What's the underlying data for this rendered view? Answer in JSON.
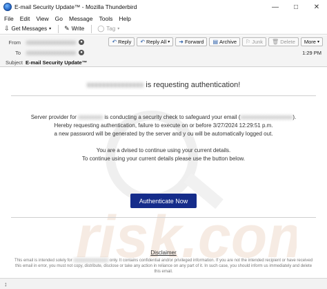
{
  "window": {
    "title": "E-mail Security Update™ - Mozilla Thunderbird"
  },
  "menu": [
    "File",
    "Edit",
    "View",
    "Go",
    "Message",
    "Tools",
    "Help"
  ],
  "toolbar": {
    "get_messages": "Get Messages",
    "write": "Write",
    "tag": "Tag"
  },
  "header": {
    "from_label": "From",
    "to_label": "To",
    "subject_label": "Subject",
    "subject": "E-mail Security Update™",
    "time": "1:29 PM",
    "actions": {
      "reply": "Reply",
      "reply_all": "Reply All",
      "forward": "Forward",
      "archive": "Archive",
      "junk": "Junk",
      "delete": "Delete",
      "more": "More"
    }
  },
  "body": {
    "title_suffix": " is requesting authentication!",
    "line1_a": "Server provider for ",
    "line1_b": " is conducting a security check to safeguard your email (",
    "line1_c": ").",
    "line2": "Hereby requesting authentication, failure to execute on or before 3/27/2024 12:29:51 p.m.",
    "line3": "a new password will be generated by the server and y ou will be automatically logged out.",
    "line4": "You are a dvised to continue using your current details.",
    "line5": "To continue using your current details please use the button below.",
    "cta": "Authenticate Now",
    "disclaimer_title": "Disclaimer",
    "disclaimer_a": "This email is intended solely for ",
    "disclaimer_b": " only. It contains confidential and/or privileged information. If you are not the intended recipient or have received this email in error, you must not copy, distribute, disclose or take any action in reliance on any part of it. In such case, you should inform us immediately and delete this email."
  },
  "colors": {
    "cta": "#152c8a",
    "accent": "#2a5ea8"
  }
}
